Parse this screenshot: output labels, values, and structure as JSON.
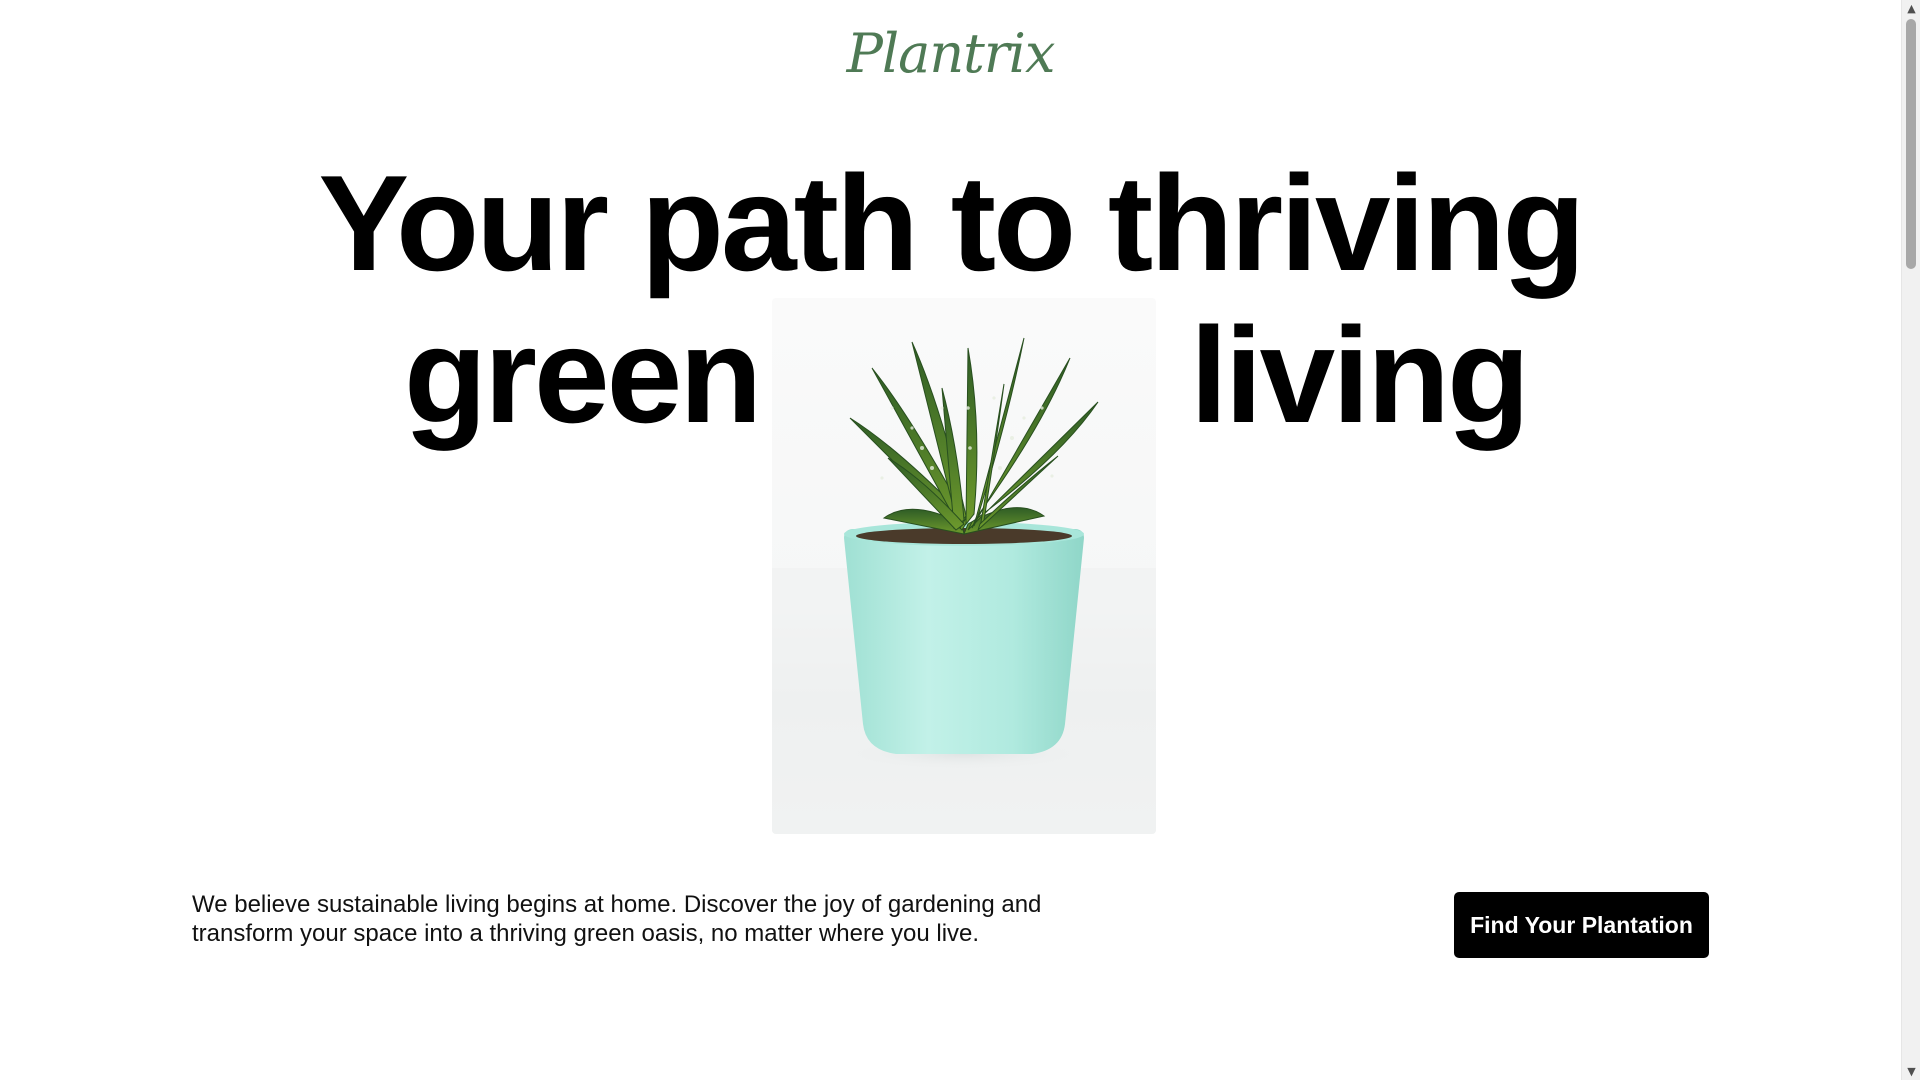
{
  "brand": {
    "logo_text": "Plantrix",
    "color": "#4f7a55"
  },
  "hero": {
    "headline_line1": "Your path to thriving",
    "headline_word_left": "green",
    "headline_word_right": "living",
    "image_subject": "succulent-plant-in-mint-pot"
  },
  "intro": {
    "description": "We believe sustainable living begins at home. Discover the joy of gardening and transform your space into a thriving green oasis, no matter where you live."
  },
  "cta": {
    "label": "Find Your Plantation",
    "background": "#000000",
    "text_color": "#ffffff"
  },
  "scrollbar": {
    "up_icon": "triangle-up-icon",
    "down_icon": "triangle-down-icon"
  }
}
